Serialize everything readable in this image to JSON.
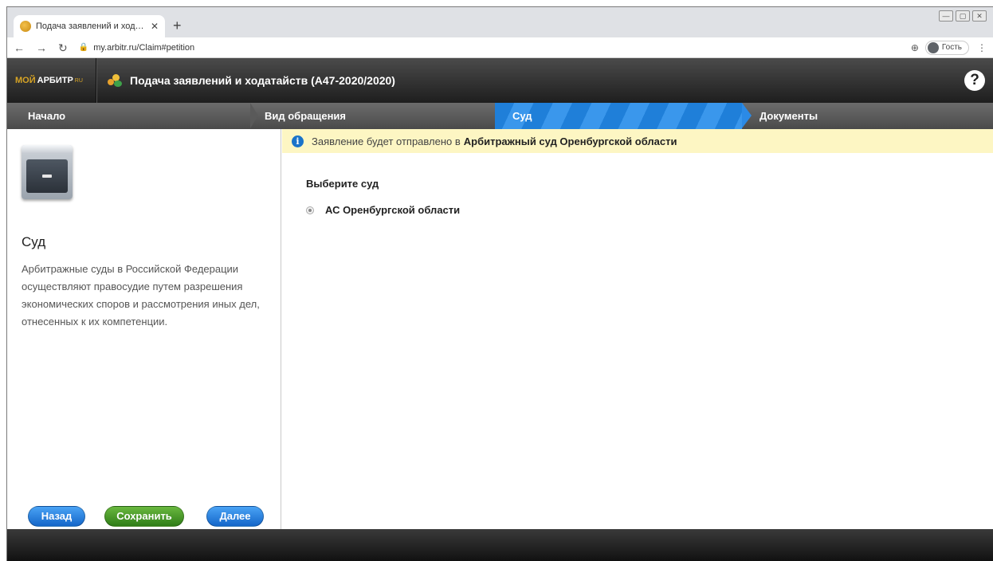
{
  "browser": {
    "tab_title": "Подача заявлений и ходатайств",
    "tab_close": "✕",
    "new_tab": "+",
    "url": "my.arbitr.ru/Claim#petition",
    "guest_label": "Гость",
    "window_controls": [
      "—",
      "▢",
      "✕"
    ]
  },
  "app": {
    "logo": {
      "part1": "МОЙ",
      "part2": "АРБИТР",
      "part3": "RU"
    },
    "title": "Подача заявлений и ходатайств  (А47-2020/2020)",
    "help": "?"
  },
  "steps": [
    {
      "label": "Начало",
      "active": false
    },
    {
      "label": "Вид обращения",
      "active": false
    },
    {
      "label": "Суд",
      "active": true
    },
    {
      "label": "Документы",
      "active": false
    }
  ],
  "sidebar": {
    "title": "Суд",
    "description": "Арбитражные суды в Российской Федерации осуществляют правосудие путем разрешения экономических споров и рассмотрения иных дел, отнесенных к их компетенции.",
    "buttons": {
      "back": "Назад",
      "save": "Сохранить",
      "next": "Далее"
    }
  },
  "main": {
    "notice_text": "Заявление будет отправлено в",
    "notice_court": "Арбитражный суд Оренбургской области",
    "select_label": "Выберите суд",
    "court_option": "АС Оренбургской области"
  },
  "colors": {
    "accent": "#2b8ae6",
    "save_button": "#3f8f22",
    "notice_bg": "#fdf6c3",
    "header_bg": "#2a2a2a"
  }
}
